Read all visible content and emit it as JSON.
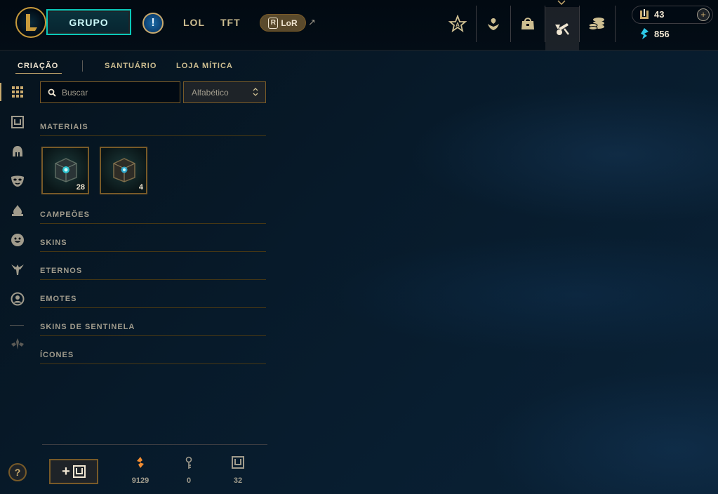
{
  "header": {
    "play_label": "GRUPO",
    "alert_symbol": "!",
    "game_tabs": [
      {
        "label": "LOL"
      },
      {
        "label": "TFT"
      }
    ],
    "lor_label": "LoR",
    "nav_icons": [
      "home-icon",
      "profile-icon",
      "collection-icon",
      "loot-icon",
      "store-icon"
    ],
    "currency": {
      "blue_essence": "43",
      "riot_points": "856"
    }
  },
  "subnav": {
    "tabs": [
      {
        "label": "CRIAÇÃO"
      },
      {
        "label": "SANTUÁRIO"
      },
      {
        "label": "LOJA MÍTICA"
      }
    ]
  },
  "sidebar_icons": [
    "grid-icon",
    "chest-icon",
    "helmet-icon",
    "mask-icon",
    "ward-icon",
    "emote-icon",
    "eternal-icon",
    "profile-icon",
    "material-icon"
  ],
  "filters": {
    "search_placeholder": "Buscar",
    "sort_value": "Alfabético"
  },
  "sections": [
    {
      "label": "MATERIAIS"
    },
    {
      "label": "CAMPEÕES"
    },
    {
      "label": "SKINS"
    },
    {
      "label": "ETERNOS"
    },
    {
      "label": "EMOTES"
    },
    {
      "label": "SKINS DE SENTINELA"
    },
    {
      "label": "ÍCONES"
    }
  ],
  "materials": [
    {
      "name": "hextech-chest",
      "count": "28"
    },
    {
      "name": "masterwork-chest",
      "count": "4"
    }
  ],
  "footer": {
    "help_symbol": "?",
    "stats": [
      {
        "icon": "orange-essence-icon",
        "value": "9129"
      },
      {
        "icon": "key-icon",
        "value": "0"
      },
      {
        "icon": "chest-icon",
        "value": "32"
      }
    ]
  },
  "colors": {
    "gold": "#c8aa6e",
    "teal": "#0ac8b9",
    "orange_essence": "#f08c32",
    "blue_essence": "#2dc8e6"
  }
}
